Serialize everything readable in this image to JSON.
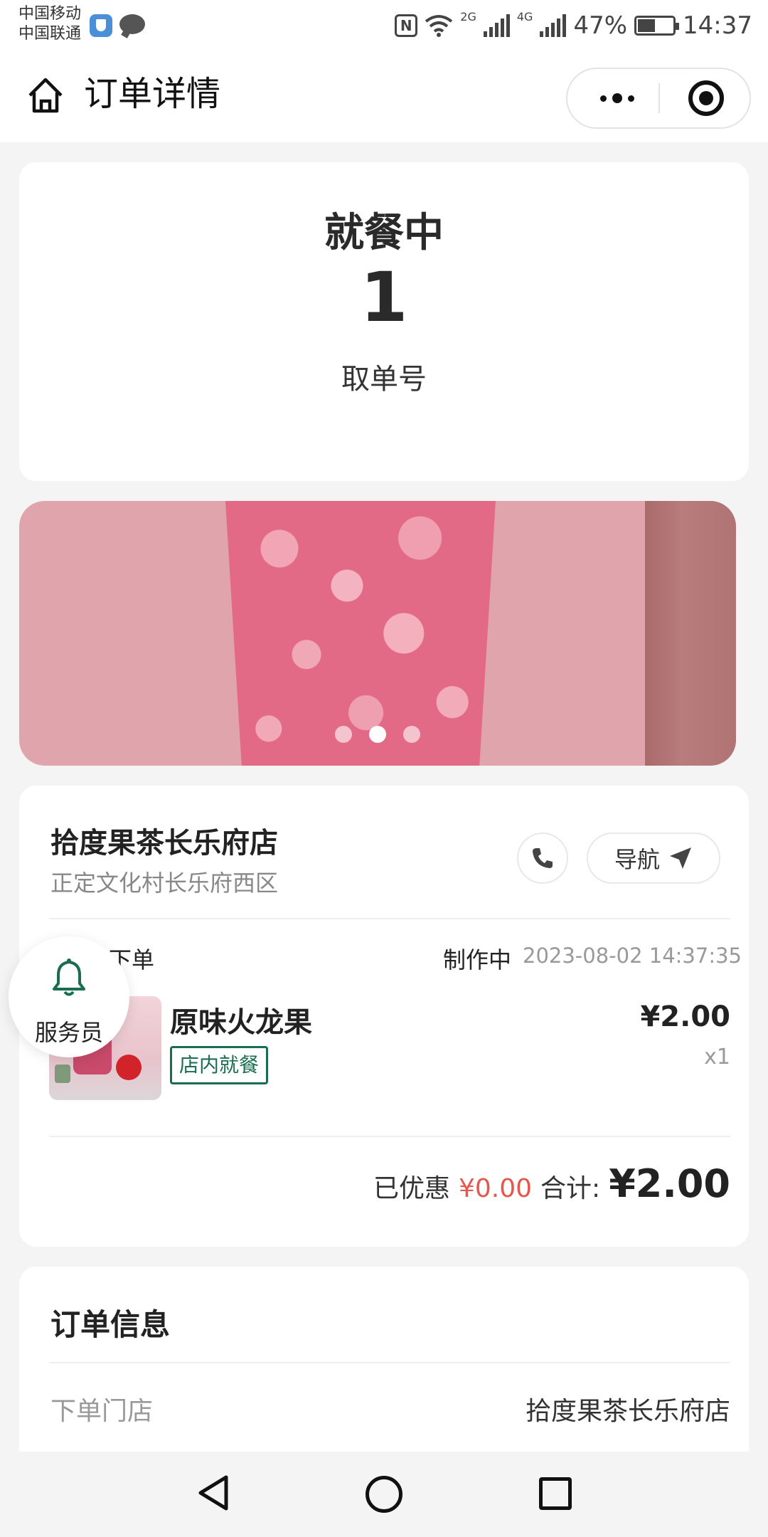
{
  "status_bar": {
    "carrier1": "中国移动",
    "carrier2": "中国联通",
    "network1": "2G",
    "network2": "4G",
    "battery": "47%",
    "time": "14:37"
  },
  "header": {
    "title": "订单详情"
  },
  "status": {
    "title": "就餐中",
    "pickup_number": "1",
    "pickup_label": "取单号"
  },
  "banner": {
    "dots_count": 3,
    "active_dot": 2
  },
  "store": {
    "name": "拾度果茶长乐府店",
    "address": "正定文化村长乐府西区",
    "nav_label": "导航",
    "order_type": "下单",
    "order_status": "制作中",
    "order_time": "2023-08-02 14:37:35",
    "item": {
      "name": "原味火龙果",
      "tag": "店内就餐",
      "price": "¥2.00",
      "qty": "x1"
    },
    "discount_label": "已优惠",
    "discount_value": "¥0.00",
    "total_label": "合计:",
    "total_value": "¥2.00"
  },
  "waiter": {
    "label": "服务员"
  },
  "order_info": {
    "title": "订单信息",
    "rows": [
      {
        "label": "下单门店",
        "value": "拾度果茶长乐府店"
      }
    ]
  },
  "colors": {
    "accent_green": "#1a6e4f",
    "discount_red": "#e5574d"
  }
}
